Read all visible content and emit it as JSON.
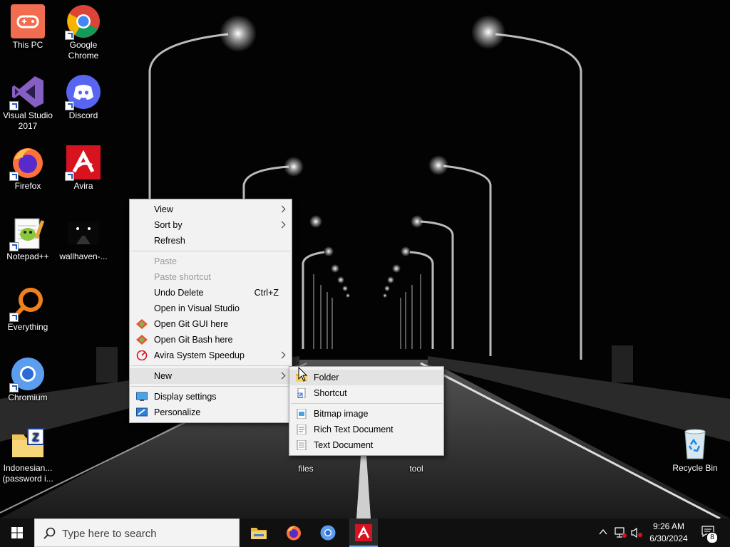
{
  "desktop": {
    "icons": [
      {
        "label": "This PC",
        "icon": "this-pc-icon"
      },
      {
        "label": "Google Chrome",
        "icon": "google-chrome-icon"
      },
      {
        "label": "Visual Studio 2017",
        "icon": "visual-studio-icon"
      },
      {
        "label": "Discord",
        "icon": "discord-icon"
      },
      {
        "label": "Firefox",
        "icon": "firefox-icon"
      },
      {
        "label": "Avira",
        "icon": "avira-icon"
      },
      {
        "label": "Notepad++",
        "icon": "notepad-plus-plus-icon"
      },
      {
        "label": "wallhaven-...",
        "icon": "wallpaper-file-icon"
      },
      {
        "label": "Everything",
        "icon": "everything-icon"
      },
      {
        "label": "Chromium",
        "icon": "chromium-icon"
      },
      {
        "label": "Indonesian... (password i...",
        "icon": "zip-folder-icon"
      },
      {
        "label": "files",
        "icon": "folder-icon"
      },
      {
        "label": "tool",
        "icon": "folder-icon"
      },
      {
        "label": "Recycle Bin",
        "icon": "recycle-bin-icon"
      }
    ]
  },
  "context_menu": {
    "items": [
      {
        "label": "View",
        "submenu": true
      },
      {
        "label": "Sort by",
        "submenu": true
      },
      {
        "label": "Refresh"
      },
      {
        "label": "Paste",
        "disabled": true
      },
      {
        "label": "Paste shortcut",
        "disabled": true
      },
      {
        "label": "Undo Delete",
        "shortcut": "Ctrl+Z"
      },
      {
        "label": "Open in Visual Studio"
      },
      {
        "label": "Open Git GUI here",
        "icon": "git-icon"
      },
      {
        "label": "Open Git Bash here",
        "icon": "git-icon"
      },
      {
        "label": "Avira System Speedup",
        "icon": "avira-speedup-icon",
        "submenu": true
      },
      {
        "label": "New",
        "submenu": true,
        "highlighted": true
      },
      {
        "label": "Display settings",
        "icon": "display-icon"
      },
      {
        "label": "Personalize",
        "icon": "personalize-icon"
      }
    ]
  },
  "new_submenu": {
    "items": [
      {
        "label": "Folder",
        "icon": "folder-icon"
      },
      {
        "label": "Shortcut",
        "icon": "shortcut-icon"
      },
      {
        "label": "Bitmap image",
        "icon": "bitmap-icon"
      },
      {
        "label": "Rich Text Document",
        "icon": "rich-text-icon"
      },
      {
        "label": "Text Document",
        "icon": "text-document-icon"
      }
    ]
  },
  "taskbar": {
    "search_placeholder": "Type here to search",
    "pinned": [
      "file-explorer-icon",
      "firefox-icon",
      "chromium-icon",
      "avira-icon"
    ],
    "time": "9:26 AM",
    "date": "6/30/2024",
    "notification_count": "8"
  },
  "colors": {
    "accent_avira": "#d6131f",
    "chrome_blue": "#3b7ddd",
    "discord": "#5865f2",
    "vs_purple": "#865fc5"
  }
}
